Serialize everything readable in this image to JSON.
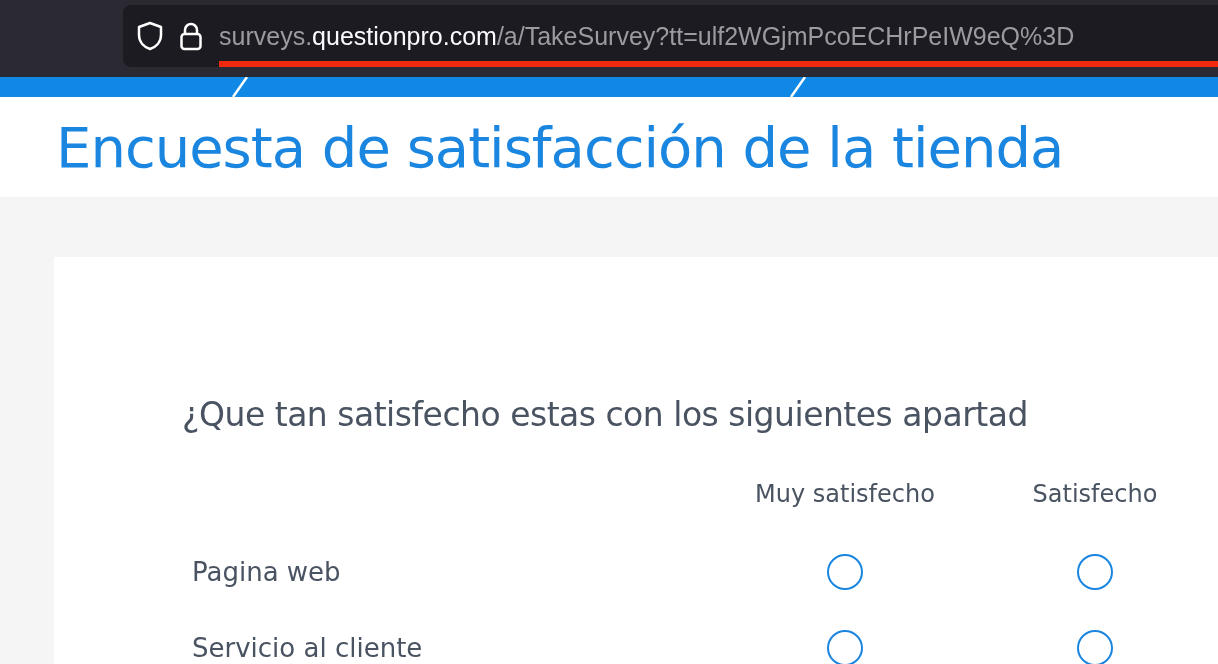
{
  "browser": {
    "url_host_prefix": "surveys.",
    "url_domain": "questionpro.com",
    "url_path": "/a/TakeSurvey?tt=ulf2WGjmPcoECHrPeIW9eQ%3D"
  },
  "survey": {
    "title": "Encuesta de satisfacción de la tienda"
  },
  "question": {
    "text": "¿Que tan satisfecho estas con los siguientes apartad",
    "columns": [
      "Muy satisfecho",
      "Satisfecho"
    ],
    "rows": [
      {
        "label": "Pagina web",
        "options": [
          {
            "selected": false
          },
          {
            "selected": false
          }
        ]
      },
      {
        "label": "Servicio al cliente",
        "options": [
          {
            "selected": false
          },
          {
            "selected": false
          }
        ]
      }
    ]
  }
}
